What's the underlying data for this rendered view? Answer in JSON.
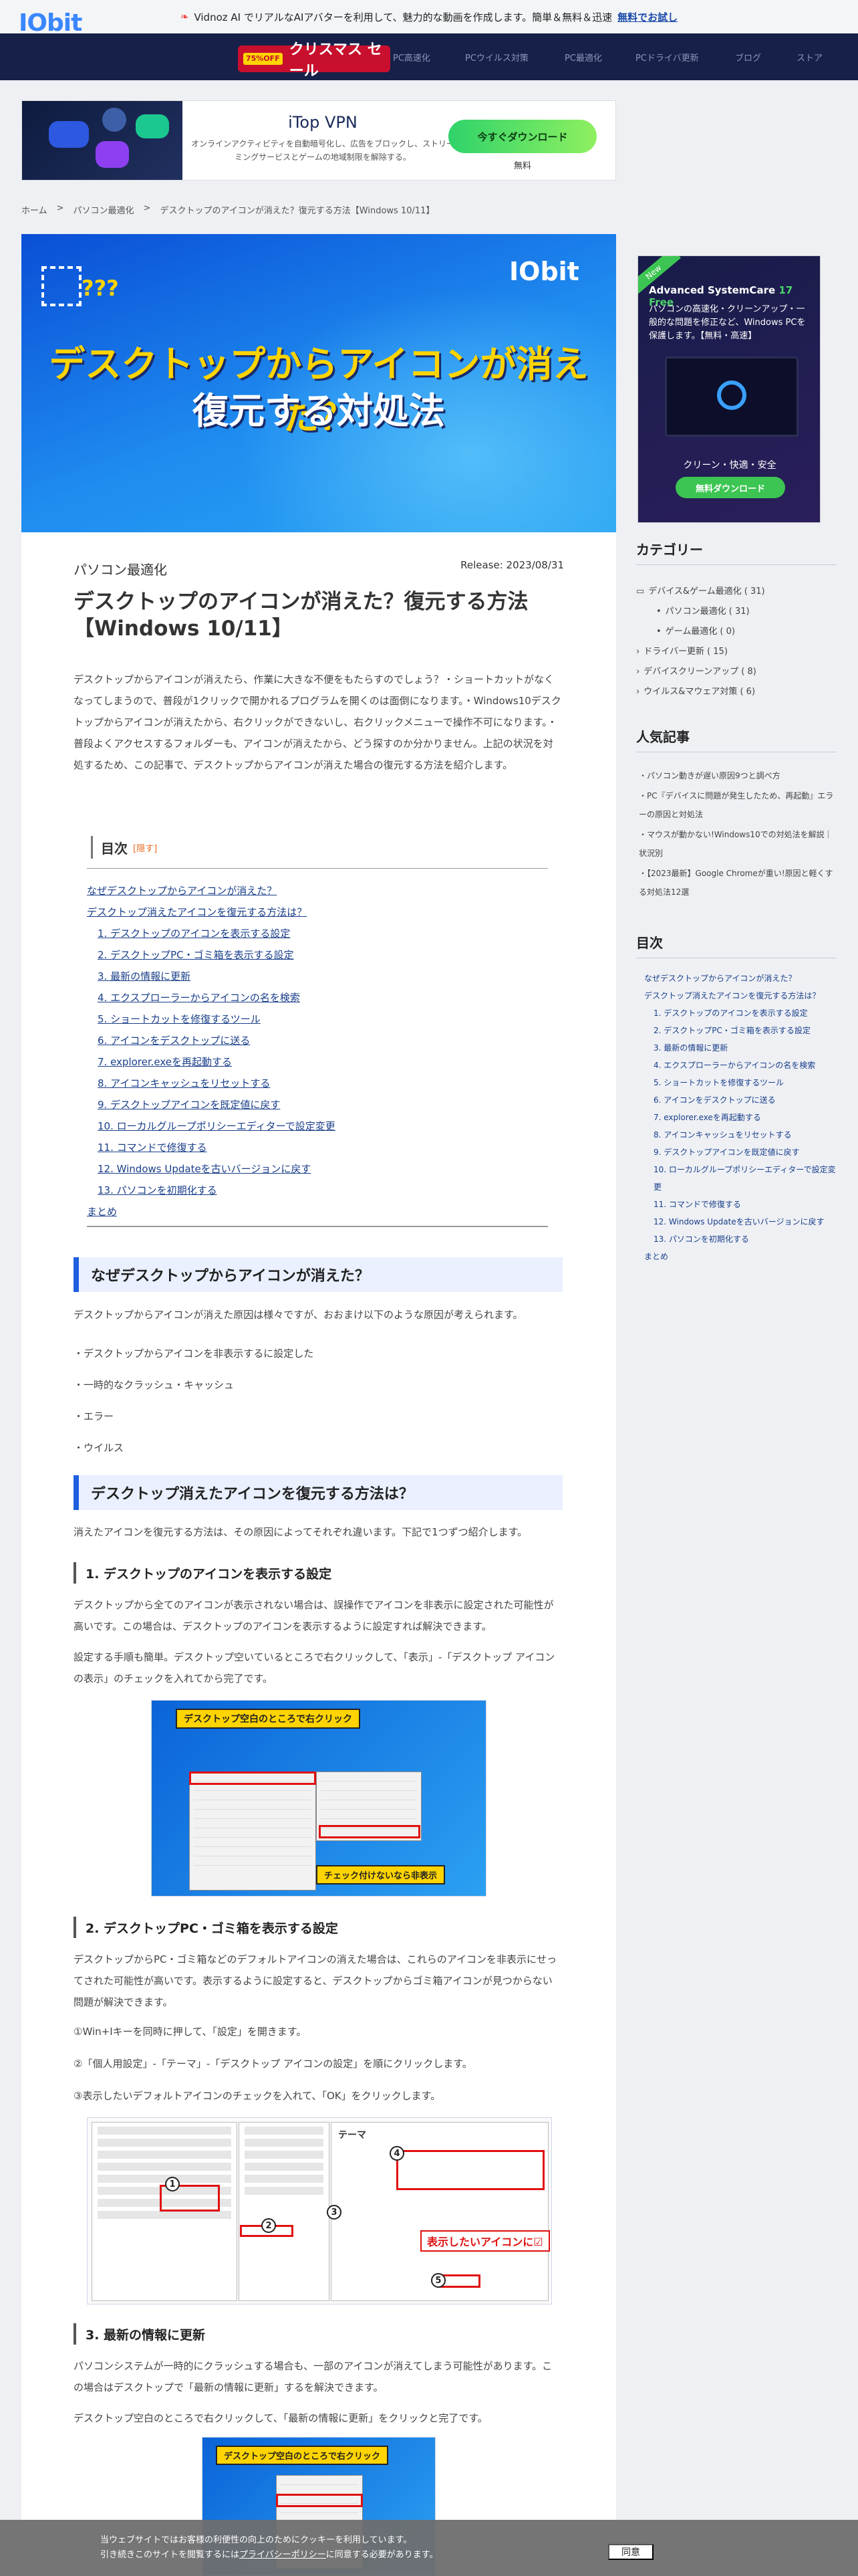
{
  "topbar": {
    "text": "Vidnoz AI でリアルなAIアバターを利用して、魅力的な動画を作成します。簡単＆無料＆迅速",
    "link": "無料でお試し"
  },
  "nav": {
    "logo": "IObit",
    "xmas_tag": "75%OFF",
    "xmas": "クリスマス セール",
    "items": [
      "PC高速化",
      "PCウイルス対策",
      "PC最適化",
      "PCドライバ更新",
      "ブログ",
      "ストア"
    ]
  },
  "ad": {
    "title": "iTop VPN",
    "text": "オンラインアクティビティを自動暗号化し、広告をブロックし、ストリーミングサービスとゲームの地域制限を解除する。",
    "button": "今すぐダウンロード",
    "free": "無料"
  },
  "breadcrumb": {
    "home": "ホーム",
    "sep": ">",
    "cat": "パソコン最適化",
    "current": "デスクトップのアイコンが消えた？復元する方法【Windows 10/11】"
  },
  "hero": {
    "q": "???",
    "brand": "IObit",
    "line1": "デスクトップからアイコンが消えた？",
    "line2": "復元する対処法"
  },
  "article": {
    "category": "パソコン最適化",
    "release": "Release: 2023/08/31",
    "title": "デスクトップのアイコンが消えた？復元する方法【Windows 10/11】",
    "intro": "デスクトップからアイコンが消えたら、作業に大きな不便をもたらすのでしょう？・ショートカットがなくなってしまうので、普段が1クリックで開かれるプログラムを開くのは面倒になります。・Windows10デスクトップからアイコンが消えたから、右クリックができないし、右クリックメニューで操作不可になります。・普段よくアクセスするフォルダーも、アイコンが消えたから、どう探すのか分かりません。上記の状況を対処するため、この記事で、デスクトップからアイコンが消えた場合の復元する方法を紹介します。"
  },
  "toc": {
    "title": "目次",
    "hide": "[隠す]",
    "items": [
      "なぜデスクトップからアイコンが消えた？",
      "デスクトップ消えたアイコンを復元する方法は？",
      "1. デスクトップのアイコンを表示する設定",
      "2. デスクトップPC・ゴミ箱を表示する設定",
      "3. 最新の情報に更新",
      "4. エクスプローラーからアイコンの名を検索",
      "5. ショートカットを修復するツール",
      "6. アイコンをデスクトップに送る",
      "7. explorer.exeを再起動する",
      "8. アイコンキャッシュをリセットする",
      "9. デスクトップアイコンを既定値に戻す",
      "10. ローカルグループポリシーエディターで設定変更",
      "11. コマンドで修復する",
      "12. Windows Updateを古いバージョンに戻す",
      "13. パソコンを初期化する",
      "まとめ"
    ]
  },
  "sec1": {
    "heading": "なぜデスクトップからアイコンが消えた？",
    "text": "デスクトップからアイコンが消えた原因は様々ですが、おおまけ以下のような原因が考えられます。",
    "reasons": [
      "・デスクトップからアイコンを非表示するに設定した",
      "・一時的なクラッシュ・キャッシュ",
      "・エラー",
      "・ウイルス"
    ]
  },
  "sec2": {
    "heading": "デスクトップ消えたアイコンを復元する方法は？",
    "text": "消えたアイコンを復元する方法は、その原因によってそれぞれ違います。下記で1つずつ紹介します。",
    "s1_heading": "1. デスクトップのアイコンを表示する設定",
    "s1_p1": "デスクトップから全てのアイコンが表示されない場合は、誤操作でアイコンを非表示に設定された可能性が高いです。この場合は、デスクトップのアイコンを表示するように設定すれば解決できます。",
    "s1_p2": "設定する手順も簡単。デスクトップ空いているところで右クリックして、「表示」-「デスクトップ アイコンの表示」のチェックを入れてから完了です。",
    "fig1_label": "デスクトップ空白のところで右クリック",
    "fig1_note": "チェック付けないなら非表示",
    "s2_heading": "2. デスクトップPC・ゴミ箱を表示する設定",
    "s2_p1": "デスクトップからPC・ゴミ箱などのデフォルトアイコンの消えた場合は、これらのアイコンを非表示にせってされた可能性が高いです。表示するように設定すると、デスクトップからゴミ箱アイコンが見つからない問題が解決できます。",
    "s2_step1": "①Win+Iキーを同時に押して、「設定」を開きます。",
    "s2_step2": "②「個人用設定」-「テーマ」-「デスクトップ アイコンの設定」を順にクリックします。",
    "s2_step3": "③表示したいデフォルトアイコンのチェックを入れて、「OK」をクリックします。",
    "fig2_label": "表示したいアイコンに☑",
    "fig2_theme": "テーマ",
    "s3_heading": "3. 最新の情報に更新",
    "s3_p1": "パソコンシステムが一時的にクラッシュする場合も、一部のアイコンが消えてしまう可能性があります。この場合はデスクトップで「最新の情報に更新」するを解決できます。",
    "s3_p2": "デスクトップ空白のところで右クリックして、「最新の情報に更新」をクリックと完了です。",
    "fig3_label": "デスクトップ空白のところで右クリック"
  },
  "sidebar": {
    "ad": {
      "new": "New",
      "title": "Advanced SystemCare ",
      "version": "17 Free",
      "text": "パソコンの高速化・クリーンアップ・一般的な問題を修正など、Windows PCを保護します。【無料・高速】",
      "slogan": "クリーン・快適・安全",
      "button": "無料ダウンロード"
    },
    "categories_title": "カテゴリー",
    "categories": [
      {
        "label": "デバイス&ゲーム最適化 ( 31)",
        "indent": 0
      },
      {
        "label": "パソコン最適化 ( 31)",
        "indent": 1
      },
      {
        "label": "ゲーム最適化 ( 0)",
        "indent": 1
      },
      {
        "label": "ドライバー更新 ( 15)",
        "indent": 0
      },
      {
        "label": "デバイスクリーンアップ ( 8)",
        "indent": 0
      },
      {
        "label": "ウイルス&マウェア対策 ( 6)",
        "indent": 0
      }
    ],
    "popular_title": "人気記事",
    "popular": [
      "・パソコン動きが遅い原因9つと調べ方",
      "・PC『デバイスに問題が発生したため、再起動』エラーの原因と対処法",
      "・マウスが動かない!Windows10での対処法を解説｜状況別",
      "・【2023最新】Google Chromeが重い!原因と軽くする対処法12選"
    ],
    "toc_title": "目次"
  },
  "cookie": {
    "text1": "当ウェブサイトではお客様の利便性の向上のためにクッキーを利用しています。",
    "text2a": "引き続きこのサイトを閲覧するには",
    "policy": "プライバシーポリシー",
    "text2b": "に同意する必要があります。",
    "button": "同意"
  }
}
